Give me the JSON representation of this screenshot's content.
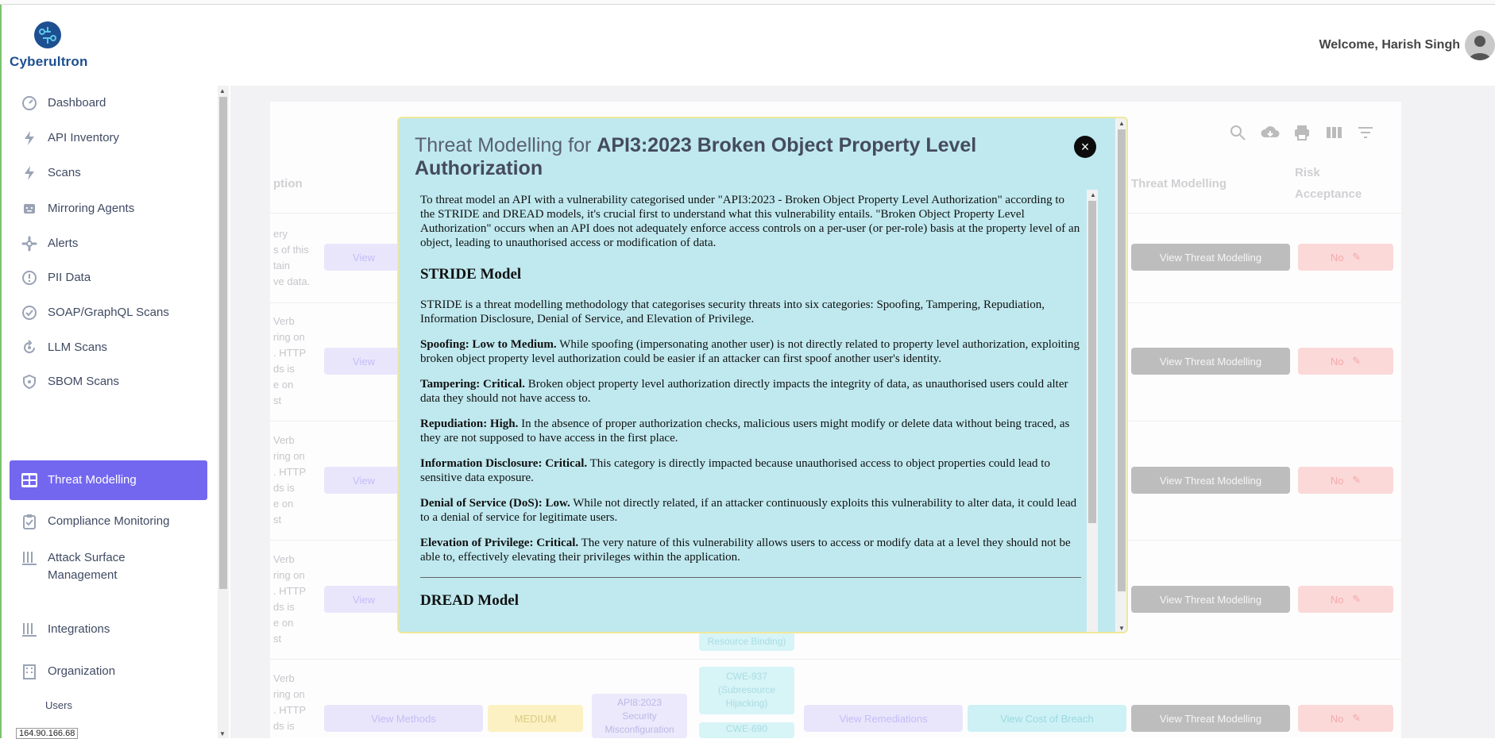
{
  "brand": {
    "name": "Cyberultron"
  },
  "header": {
    "welcome": "Welcome, Harish Singh"
  },
  "sidebar": {
    "items": [
      {
        "label": "Dashboard",
        "icon": "dashboard-icon"
      },
      {
        "label": "API Inventory",
        "icon": "bolt-icon"
      },
      {
        "label": "Scans",
        "icon": "bolt-icon"
      },
      {
        "label": "Mirroring Agents",
        "icon": "robot-icon"
      },
      {
        "label": "Alerts",
        "icon": "alert-icon"
      },
      {
        "label": "PII Data",
        "icon": "info-icon"
      },
      {
        "label": "SOAP/GraphQL Scans",
        "icon": "check-circle-icon"
      },
      {
        "label": "LLM Scans",
        "icon": "refresh-icon"
      },
      {
        "label": "SBOM Scans",
        "icon": "shield-icon"
      },
      {
        "label": "Threat Modelling",
        "icon": "grid-icon",
        "active": true
      },
      {
        "label": "Compliance Monitoring",
        "icon": "clipboard-icon"
      },
      {
        "label": "Attack Surface",
        "label2": "Management",
        "icon": "bars-icon"
      },
      {
        "label": "Integrations",
        "icon": "bars-icon"
      },
      {
        "label": "Organization",
        "icon": "building-icon"
      }
    ],
    "subitems": [
      "Users"
    ],
    "status_ip": "164.90.166.68"
  },
  "table": {
    "headers": {
      "description": "ption",
      "threat": "Threat Modelling",
      "risk1": "Risk",
      "risk2": "Acceptance"
    },
    "row_fragments": [
      [
        "ery",
        "s of this",
        "tain",
        "ve data."
      ],
      [
        "Verb",
        "ring on",
        ". HTTP",
        "ds is",
        "e on",
        "st"
      ],
      [
        "Verb",
        "ring on",
        ". HTTP",
        "ds is",
        "e on",
        "st"
      ],
      [
        "Verb",
        "ring on",
        ". HTTP",
        "ds is",
        "e on",
        "st"
      ],
      [
        "Verb",
        "ring on",
        ". HTTP",
        "ds is"
      ]
    ],
    "view_label": "View",
    "view_methods": "View Methods",
    "severity": "MEDIUM",
    "owasp": [
      "API8:2023",
      "Security",
      "Misconfiguration"
    ],
    "cwe_partial": "Resource Binding)",
    "cwe_a": [
      "CWE-937",
      "(Subresource",
      "Hijacking)"
    ],
    "cwe_b": "CWE-690",
    "view_remediations": "View Remediations",
    "view_cost": "View Cost of Breach",
    "view_threat": "View Threat Modelling",
    "risk_value": "No"
  },
  "modal": {
    "title_prefix": "Threat Modelling for ",
    "title_bold": "API3:2023 Broken Object Property Level Authorization",
    "intro": "To threat model an API with a vulnerability categorised under \"API3:2023 - Broken Object Property Level Authorization\" according to the STRIDE and DREAD models, it's crucial first to understand what this vulnerability entails. \"Broken Object Property Level Authorization\" occurs when an API does not adequately enforce access controls on a per-user (or per-role) basis at the property level of an object, leading to unauthorised access or modification of data.",
    "stride_heading": "STRIDE Model",
    "stride_intro": "STRIDE is a threat modelling methodology that categorises security threats into six categories: Spoofing, Tampering, Repudiation, Information Disclosure, Denial of Service, and Elevation of Privilege.",
    "stride_items": [
      {
        "label": "Spoofing: Low to Medium.",
        "text": " While spoofing (impersonating another user) is not directly related to property level authorization, exploiting broken object property level authorization could be easier if an attacker can first spoof another user's identity."
      },
      {
        "label": "Tampering: Critical.",
        "text": " Broken object property level authorization directly impacts the integrity of data, as unauthorised users could alter data they should not have access to."
      },
      {
        "label": "Repudiation: High.",
        "text": " In the absence of proper authorization checks, malicious users might modify or delete data without being traced, as they are not supposed to have access in the first place."
      },
      {
        "label": "Information Disclosure: Critical.",
        "text": " This category is directly impacted because unauthorised access to object properties could lead to sensitive data exposure."
      },
      {
        "label": "Denial of Service (DoS): Low.",
        "text": " While not directly related, if an attacker continuously exploits this vulnerability to alter data, it could lead to a denial of service for legitimate users."
      },
      {
        "label": "Elevation of Privilege: Critical.",
        "text": " The very nature of this vulnerability allows users to access or modify data at a level they should not be able to, effectively elevating their privileges within the application."
      }
    ],
    "dread_heading": "DREAD Model",
    "close_symbol": "×"
  }
}
